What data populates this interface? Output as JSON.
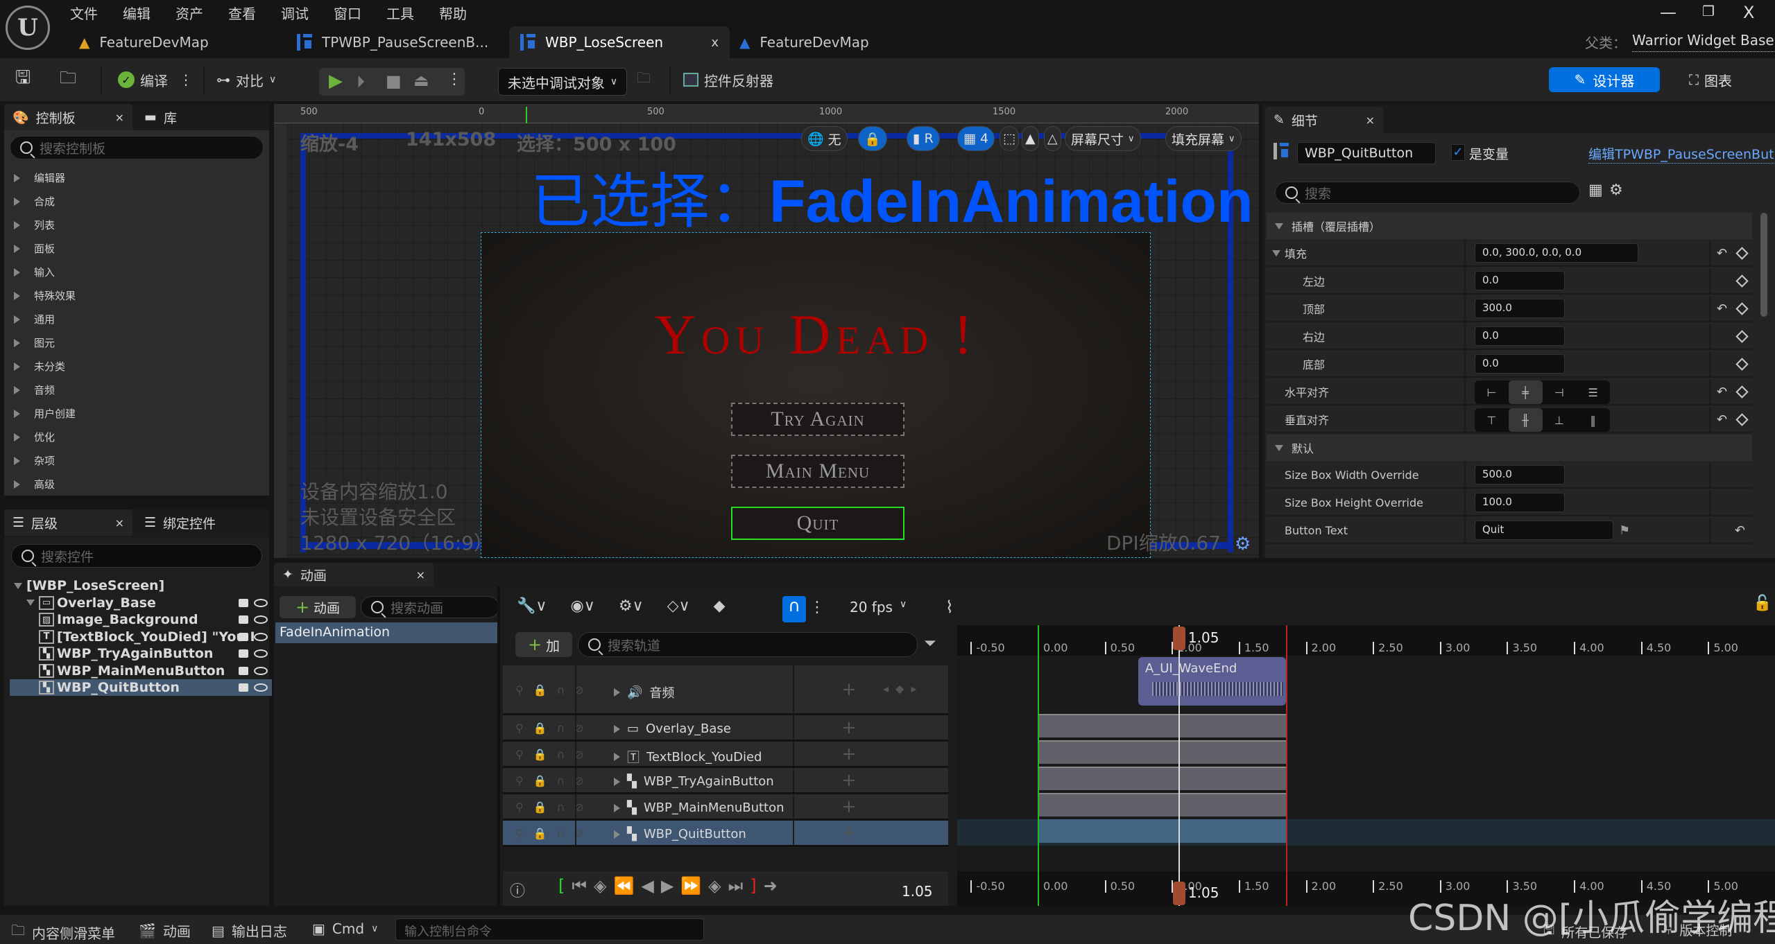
{
  "menu": [
    "文件",
    "编辑",
    "资产",
    "查看",
    "调试",
    "窗口",
    "工具",
    "帮助"
  ],
  "doc_tabs": [
    {
      "label": "FeatureDevMap",
      "icon": "level-icon",
      "active": false
    },
    {
      "label": "TPWBP_PauseScreenB...",
      "icon": "widget-blueprint-icon",
      "active": false
    },
    {
      "label": "WBP_LoseScreen",
      "icon": "widget-blueprint-icon",
      "active": true
    },
    {
      "label": "FeatureDevMap",
      "icon": "level-icon",
      "active": false
    }
  ],
  "parent_class": {
    "label": "父类：",
    "value": "Warrior Widget Base"
  },
  "toolbar": {
    "compile": "编译",
    "diff": "对比",
    "debug_target": "未选中调试对象",
    "widget_reflector": "控件反射器",
    "designer": "设计器",
    "graph": "图表"
  },
  "palette": {
    "tab": "控制板",
    "library_tab": "库",
    "search_placeholder": "搜索控制板",
    "categories": [
      "编辑器",
      "合成",
      "列表",
      "面板",
      "输入",
      "特殊效果",
      "通用",
      "图元",
      "未分类",
      "音频",
      "用户创建",
      "优化",
      "杂项",
      "高级"
    ]
  },
  "hierarchy": {
    "tab": "层级",
    "bind_tab": "绑定控件",
    "search_placeholder": "搜索控件",
    "items": [
      {
        "label": "[WBP_LoseScreen]",
        "depth": 0,
        "icon": "root"
      },
      {
        "label": "Overlay_Base",
        "depth": 1,
        "icon": "overlay-icon"
      },
      {
        "label": "Image_Background",
        "depth": 2,
        "icon": "image-icon"
      },
      {
        "label": "[TextBlock_YouDied] \"You I",
        "depth": 2,
        "icon": "text-icon"
      },
      {
        "label": "WBP_TryAgainButton",
        "depth": 2,
        "icon": "widget-icon"
      },
      {
        "label": "WBP_MainMenuButton",
        "depth": 2,
        "icon": "widget-icon"
      },
      {
        "label": "WBP_QuitButton",
        "depth": 2,
        "icon": "widget-icon",
        "selected": true
      }
    ]
  },
  "viewport": {
    "ruler_labels": [
      "500",
      "0",
      "500",
      "1000",
      "1500",
      "2000"
    ],
    "zoom": "缩放-4",
    "size": "141x508",
    "selection": "选择：500 x 100",
    "selected_label": "已选择：",
    "selected_anim": "FadeInAnimation",
    "tool_none": "无",
    "tool_r": "R",
    "grid_snap": "4",
    "screen_size": "屏幕尺寸",
    "fill_screen": "填充屏幕",
    "device_scale": "设备内容缩放1.0",
    "safe_zone": "未设置设备安全区",
    "resolution": "1280 x 720（16:9）",
    "dpi": "DPI缩放0.67",
    "canvas_title": "You Dead !",
    "buttons": [
      "Try Again",
      "Main Menu",
      "Quit"
    ]
  },
  "details": {
    "tab": "细节",
    "name_value": "WBP_QuitButton",
    "is_variable_label": "是变量",
    "is_variable": true,
    "edit_link": "编辑TPWBP_PauseScreenBut",
    "search_placeholder": "搜索",
    "slot_section": "插槽（覆层插槽）",
    "padding": {
      "label": "填充",
      "value": "0.0, 300.0, 0.0, 0.0",
      "left": {
        "label": "左边",
        "value": "0.0"
      },
      "top": {
        "label": "顶部",
        "value": "300.0"
      },
      "right": {
        "label": "右边",
        "value": "0.0"
      },
      "bottom": {
        "label": "底部",
        "value": "0.0"
      }
    },
    "h_align": {
      "label": "水平对齐",
      "selected": "center"
    },
    "v_align": {
      "label": "垂直对齐",
      "selected": "center"
    },
    "default_section": "默认",
    "size_box_width": {
      "label": "Size Box Width Override",
      "value": "500.0"
    },
    "size_box_height": {
      "label": "Size Box Height Override",
      "value": "100.0"
    },
    "button_text": {
      "label": "Button Text",
      "value": "Quit"
    }
  },
  "animation": {
    "tab": "动画",
    "add_anim": "动画",
    "search_anim_placeholder": "搜索动画",
    "anim_list": [
      "FadeInAnimation"
    ],
    "fps": "20 fps",
    "add_track": "加",
    "search_track_placeholder": "搜索轨道",
    "tracks": [
      {
        "label": "音频",
        "icon": "speaker-icon"
      },
      {
        "label": "Overlay_Base",
        "icon": "overlay-icon"
      },
      {
        "label": "TextBlock_YouDied",
        "icon": "text-icon"
      },
      {
        "label": "WBP_TryAgainButton",
        "icon": "widget-icon"
      },
      {
        "label": "WBP_MainMenuButton",
        "icon": "widget-icon"
      },
      {
        "label": "WBP_QuitButton",
        "icon": "widget-icon",
        "selected": true
      }
    ],
    "current_time": "1.05",
    "playhead": 1.05,
    "range_start": 0.0,
    "range_end": 1.85,
    "view_min": -0.6,
    "view_max": 5.5,
    "ticks": [
      "-0.50",
      "0.00",
      "0.50",
      "1.00",
      "1.50",
      "2.00",
      "2.50",
      "3.00",
      "3.50",
      "4.00",
      "4.50",
      "5.00"
    ],
    "audio_clip": {
      "label": "A_UI_WaveEnd",
      "start": 0.75,
      "end": 1.85
    }
  },
  "statusbar": {
    "content_drawer": "内容侧滑菜单",
    "animation": "动画",
    "output_log": "输出日志",
    "cmd": "Cmd",
    "cmd_placeholder": "输入控制台命令",
    "all_saved": "所有已保存",
    "source_control": "版本控制"
  },
  "watermark": "CSDN @[小瓜偷学编程]"
}
